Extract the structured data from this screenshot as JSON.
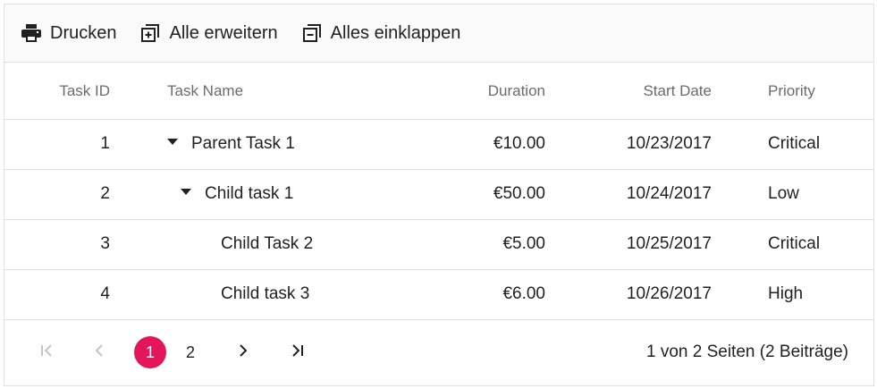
{
  "toolbar": {
    "items": [
      {
        "label": "Drucken",
        "icon": "print-icon"
      },
      {
        "label": "Alle erweitern",
        "icon": "expand-all-icon"
      },
      {
        "label": "Alles einklappen",
        "icon": "collapse-all-icon"
      }
    ]
  },
  "columns": {
    "task_id": "Task ID",
    "task_name": "Task Name",
    "duration": "Duration",
    "start_date": "Start Date",
    "priority": "Priority"
  },
  "rows": [
    {
      "id": "1",
      "name": "Parent Task 1",
      "duration": "€10.00",
      "start_date": "10/23/2017",
      "priority": "Critical",
      "level": 0,
      "expanded": true
    },
    {
      "id": "2",
      "name": "Child task 1",
      "duration": "€50.00",
      "start_date": "10/24/2017",
      "priority": "Low",
      "level": 1,
      "expanded": true
    },
    {
      "id": "3",
      "name": "Child Task 2",
      "duration": "€5.00",
      "start_date": "10/25/2017",
      "priority": "Critical",
      "level": 2,
      "expanded": null
    },
    {
      "id": "4",
      "name": "Child task 3",
      "duration": "€6.00",
      "start_date": "10/26/2017",
      "priority": "High",
      "level": 2,
      "expanded": null
    }
  ],
  "pager": {
    "pages": [
      "1",
      "2"
    ],
    "current_page": "1",
    "info": "1 von 2 Seiten (2 Beiträge)",
    "accent_color": "#e3165b"
  }
}
